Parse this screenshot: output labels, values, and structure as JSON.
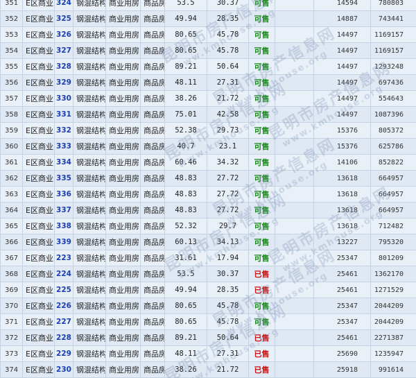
{
  "rows": [
    [
      "351",
      "E区商业",
      "324",
      "钢混结构",
      "商业用房",
      "商品房",
      "53.5",
      "30.37",
      "可售",
      "14594",
      "780803"
    ],
    [
      "352",
      "E区商业",
      "325",
      "钢混结构",
      "商业用房",
      "商品房",
      "49.94",
      "28.35",
      "可售",
      "14887",
      "743441"
    ],
    [
      "353",
      "E区商业",
      "326",
      "钢混结构",
      "商业用房",
      "商品房",
      "80.65",
      "45.78",
      "可售",
      "14497",
      "1169157"
    ],
    [
      "354",
      "E区商业",
      "327",
      "钢混结构",
      "商业用房",
      "商品房",
      "80.65",
      "45.78",
      "可售",
      "14497",
      "1169157"
    ],
    [
      "355",
      "E区商业",
      "328",
      "钢混结构",
      "商业用房",
      "商品房",
      "89.21",
      "50.64",
      "可售",
      "14497",
      "1293248"
    ],
    [
      "356",
      "E区商业",
      "329",
      "钢混结构",
      "商业用房",
      "商品房",
      "48.11",
      "27.31",
      "可售",
      "14497",
      "697436"
    ],
    [
      "357",
      "E区商业",
      "330",
      "钢混结构",
      "商业用房",
      "商品房",
      "38.26",
      "21.72",
      "可售",
      "14497",
      "554643"
    ],
    [
      "358",
      "E区商业",
      "331",
      "钢混结构",
      "商业用房",
      "商品房",
      "75.01",
      "42.58",
      "可售",
      "14497",
      "1087396"
    ],
    [
      "359",
      "E区商业",
      "332",
      "钢混结构",
      "商业用房",
      "商品房",
      "52.38",
      "29.73",
      "可售",
      "15376",
      "805372"
    ],
    [
      "360",
      "E区商业",
      "333",
      "钢混结构",
      "商业用房",
      "商品房",
      "40.7",
      "23.1",
      "可售",
      "15376",
      "625786"
    ],
    [
      "361",
      "E区商业",
      "334",
      "钢混结构",
      "商业用房",
      "商品房",
      "60.46",
      "34.32",
      "可售",
      "14106",
      "852822"
    ],
    [
      "362",
      "E区商业",
      "335",
      "钢混结构",
      "商业用房",
      "商品房",
      "48.83",
      "27.72",
      "可售",
      "13618",
      "664957"
    ],
    [
      "363",
      "E区商业",
      "336",
      "钢混结构",
      "商业用房",
      "商品房",
      "48.83",
      "27.72",
      "可售",
      "13618",
      "664957"
    ],
    [
      "364",
      "E区商业",
      "337",
      "钢混结构",
      "商业用房",
      "商品房",
      "48.83",
      "27.72",
      "可售",
      "13618",
      "664957"
    ],
    [
      "365",
      "E区商业",
      "338",
      "钢混结构",
      "商业用房",
      "商品房",
      "52.32",
      "29.7",
      "可售",
      "13618",
      "712482"
    ],
    [
      "366",
      "E区商业",
      "339",
      "钢混结构",
      "商业用房",
      "商品房",
      "60.13",
      "34.13",
      "可售",
      "13227",
      "795320"
    ],
    [
      "367",
      "E区商业",
      "223",
      "钢混结构",
      "商业用房",
      "商品房",
      "31.61",
      "17.94",
      "可售",
      "25347",
      "801209"
    ],
    [
      "368",
      "E区商业",
      "224",
      "钢混结构",
      "商业用房",
      "商品房",
      "53.5",
      "30.37",
      "已售",
      "25461",
      "1362170"
    ],
    [
      "369",
      "E区商业",
      "225",
      "钢混结构",
      "商业用房",
      "商品房",
      "49.94",
      "28.35",
      "已售",
      "25461",
      "1271529"
    ],
    [
      "370",
      "E区商业",
      "226",
      "钢混结构",
      "商业用房",
      "商品房",
      "80.65",
      "45.78",
      "可售",
      "25347",
      "2044209"
    ],
    [
      "371",
      "E区商业",
      "227",
      "钢混结构",
      "商业用房",
      "商品房",
      "80.65",
      "45.78",
      "可售",
      "25347",
      "2044209"
    ],
    [
      "372",
      "E区商业",
      "228",
      "钢混结构",
      "商业用房",
      "商品房",
      "89.21",
      "50.64",
      "已售",
      "25461",
      "2271387"
    ],
    [
      "373",
      "E区商业",
      "229",
      "钢混结构",
      "商业用房",
      "商品房",
      "48.11",
      "27.31",
      "已售",
      "25690",
      "1235947"
    ],
    [
      "374",
      "E区商业",
      "230",
      "钢混结构",
      "商业用房",
      "商品房",
      "38.26",
      "21.72",
      "已售",
      "25918",
      "991614"
    ]
  ],
  "status_colors": {
    "可售": "#1a8a1a",
    "已售": "#cc1111"
  },
  "watermark": {
    "cn": "昆明市房产信息网",
    "url": "www.kmhouse.org"
  }
}
